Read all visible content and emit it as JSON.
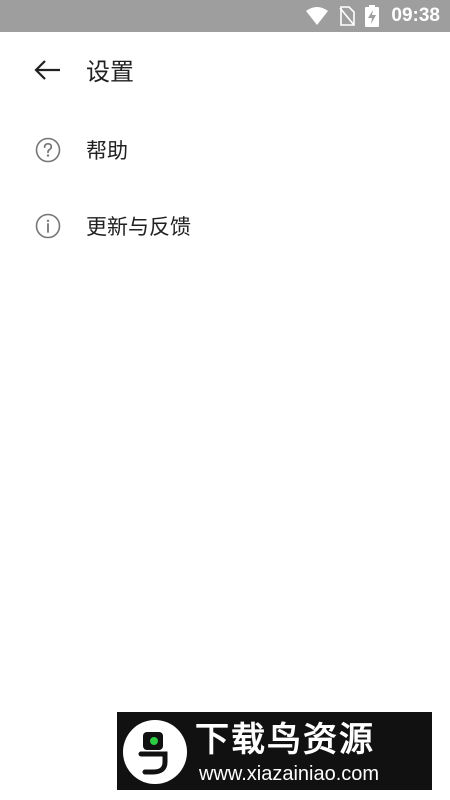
{
  "status_bar": {
    "time": "09:38",
    "icons": [
      "wifi-icon",
      "no-sim-icon",
      "battery-charging-icon"
    ]
  },
  "toolbar": {
    "back_icon": "arrow-left-icon",
    "title": "设置"
  },
  "settings": {
    "items": [
      {
        "label": "帮助",
        "icon": "help-circle-icon"
      },
      {
        "label": "更新与反馈",
        "icon": "info-circle-icon"
      }
    ]
  },
  "watermark": {
    "title": "下载鸟资源",
    "url": "www.xiazainiao.com"
  },
  "colors": {
    "status_bar_bg": "#9e9e9e",
    "text_primary": "#212121",
    "icon_gray": "#757575",
    "watermark_bg": "#111111",
    "watermark_accent": "#2ecc40"
  }
}
